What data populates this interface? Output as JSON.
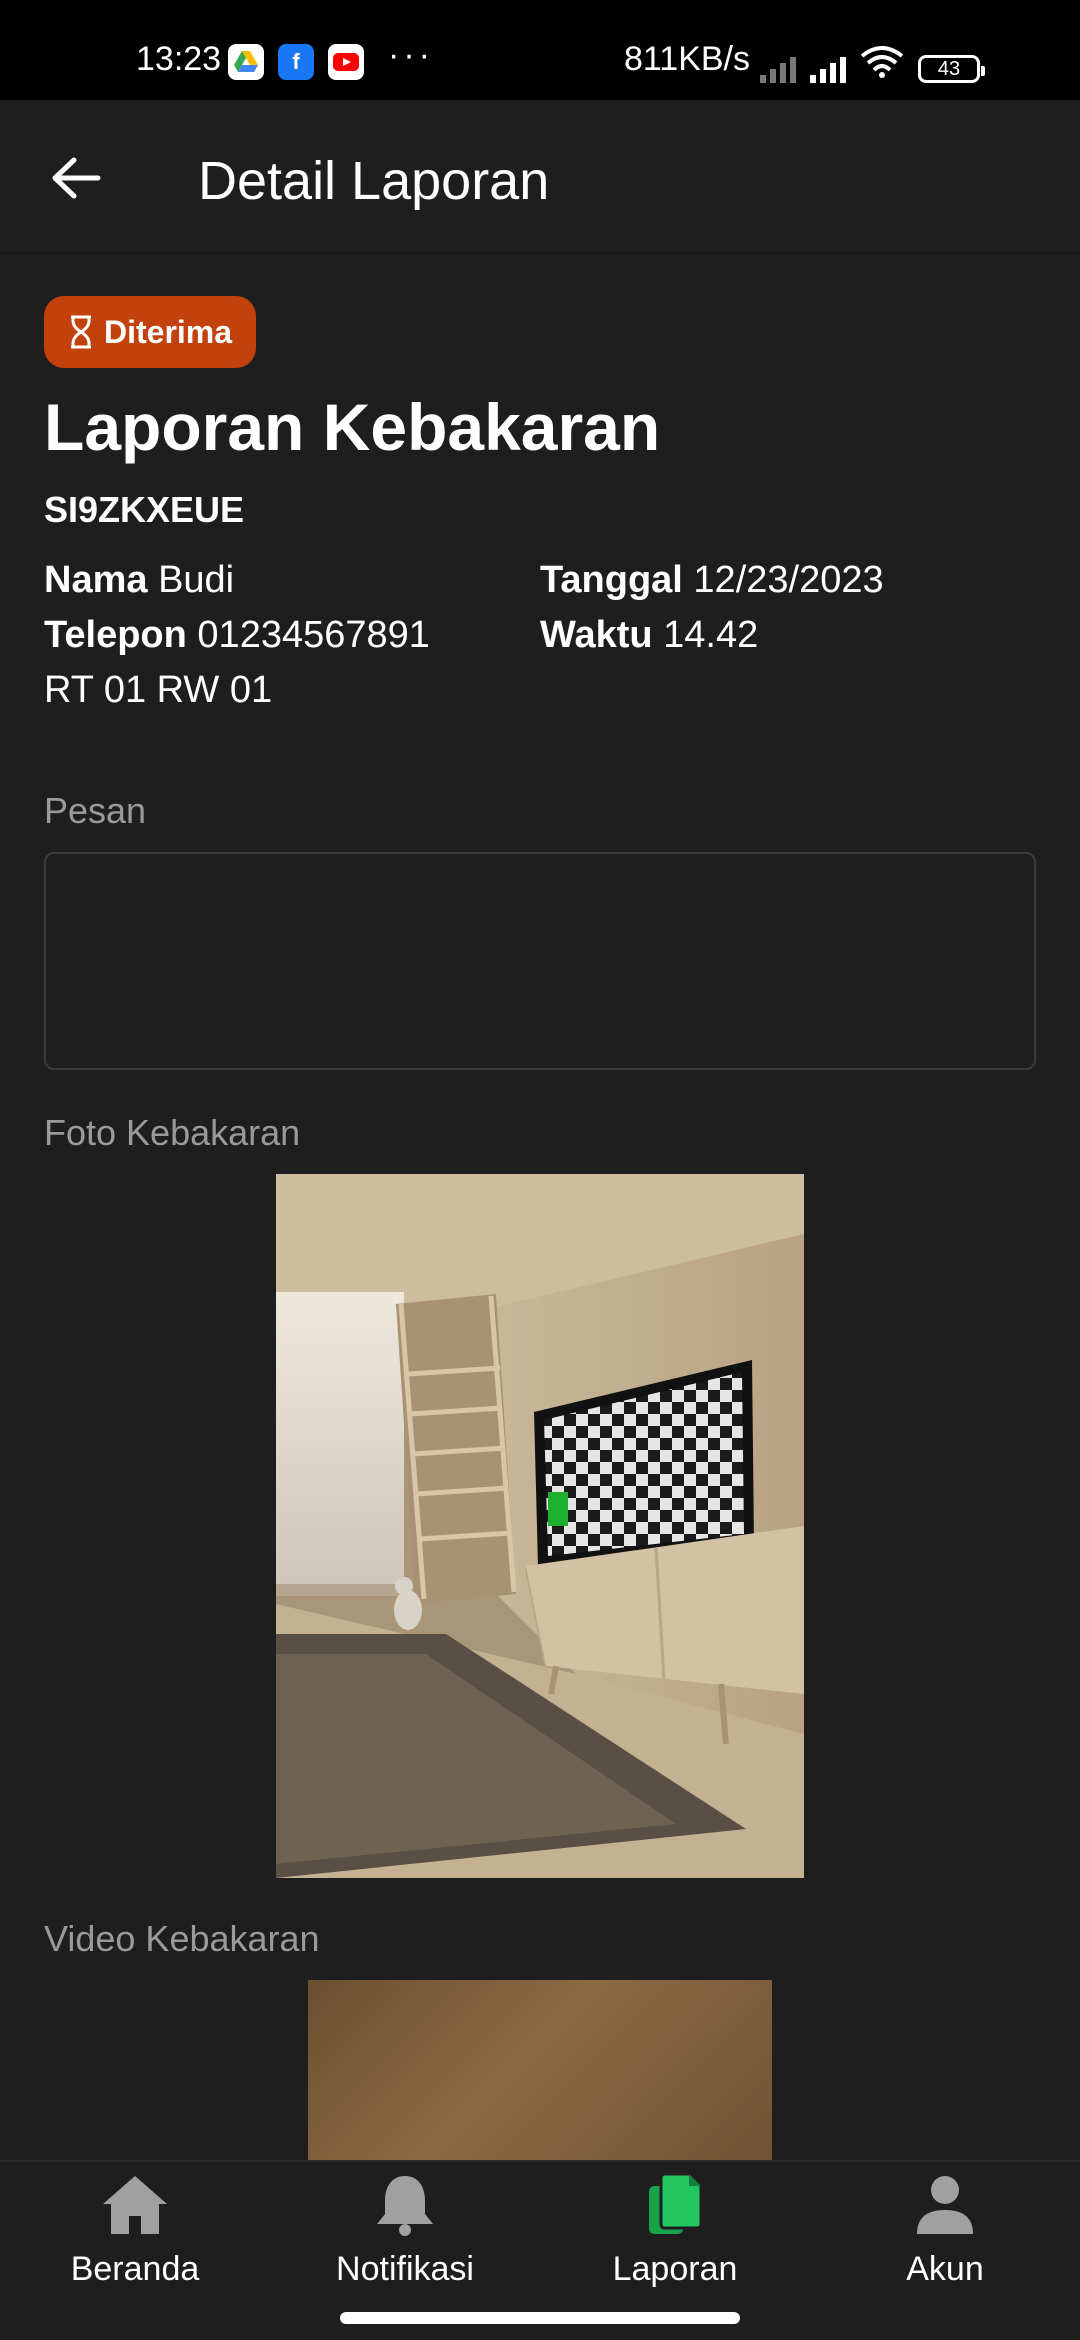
{
  "status_bar": {
    "time": "13:23",
    "network_speed": "811KB/s",
    "battery": "43",
    "more": "···"
  },
  "app_bar": {
    "title": "Detail Laporan"
  },
  "report": {
    "status": "Diterima",
    "title": "Laporan Kebakaran",
    "code": "SI9ZKXEUE",
    "nama_label": "Nama",
    "nama_value": "Budi",
    "tanggal_label": "Tanggal",
    "tanggal_value": "12/23/2023",
    "telepon_label": "Telepon",
    "telepon_value": "01234567891",
    "waktu_label": "Waktu",
    "waktu_value": "14.42",
    "address": "RT 01 RW 01"
  },
  "sections": {
    "pesan_label": "Pesan",
    "pesan_value": "",
    "foto_label": "Foto Kebakaran",
    "video_label": "Video Kebakaran"
  },
  "bottom_nav": {
    "items": [
      {
        "label": "Beranda",
        "icon": "home-icon"
      },
      {
        "label": "Notifikasi",
        "icon": "bell-icon"
      },
      {
        "label": "Laporan",
        "icon": "report-icon",
        "active": true
      },
      {
        "label": "Akun",
        "icon": "user-icon"
      }
    ]
  },
  "colors": {
    "background": "#1e1e1e",
    "badge": "#c2410c",
    "active_nav": "#16a34a"
  }
}
